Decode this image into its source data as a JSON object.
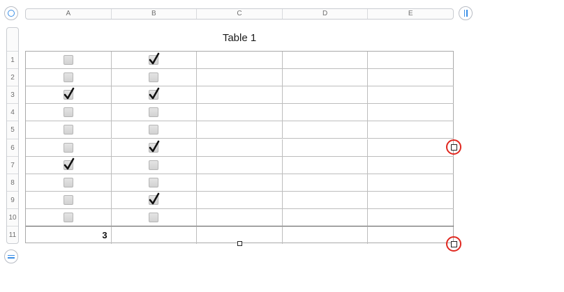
{
  "table": {
    "title": "Table 1",
    "columns": [
      "A",
      "B",
      "C",
      "D",
      "E"
    ],
    "rows": [
      "1",
      "2",
      "3",
      "4",
      "5",
      "6",
      "7",
      "8",
      "9",
      "10",
      "11"
    ],
    "checkboxes": {
      "A": [
        false,
        false,
        true,
        false,
        false,
        false,
        true,
        false,
        false,
        false
      ],
      "B": [
        true,
        false,
        true,
        false,
        false,
        true,
        false,
        false,
        true,
        false
      ]
    },
    "footer": {
      "A": "3"
    }
  }
}
